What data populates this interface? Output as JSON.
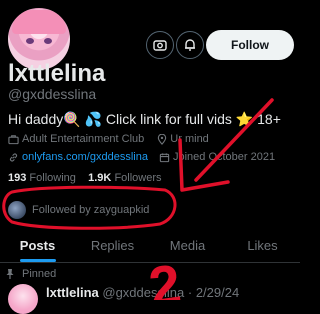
{
  "profile": {
    "display_name": "lxttlelina",
    "handle": "@gxddesslina",
    "bio": "Hi daddy🍭 💦 Click link for full vids ⭐ 18+",
    "category": "Adult Entertainment Club",
    "location": "Ur mind",
    "website": "onlyfans.com/gxddesslina",
    "joined": "Joined October 2021",
    "following_count": "193",
    "following_label": "Following",
    "followers_count": "1.9K",
    "followers_label": "Followers",
    "followed_by": "Followed by zayguapkid"
  },
  "actions": {
    "follow_label": "Follow"
  },
  "tabs": [
    {
      "label": "Posts",
      "active": true
    },
    {
      "label": "Replies",
      "active": false
    },
    {
      "label": "Media",
      "active": false
    },
    {
      "label": "Likes",
      "active": false
    }
  ],
  "pinned_post": {
    "pinned_label": "Pinned",
    "author_name": "lxttlelina",
    "author_handle": "@gxddesslina",
    "date": "2/29/24"
  },
  "annotations": {
    "circle_color": "#e0102a",
    "arrow_label": "2"
  },
  "icons": [
    "more-options-icon",
    "notification-bell-icon",
    "briefcase-icon",
    "location-pin-icon",
    "link-icon",
    "calendar-icon",
    "pin-icon"
  ]
}
